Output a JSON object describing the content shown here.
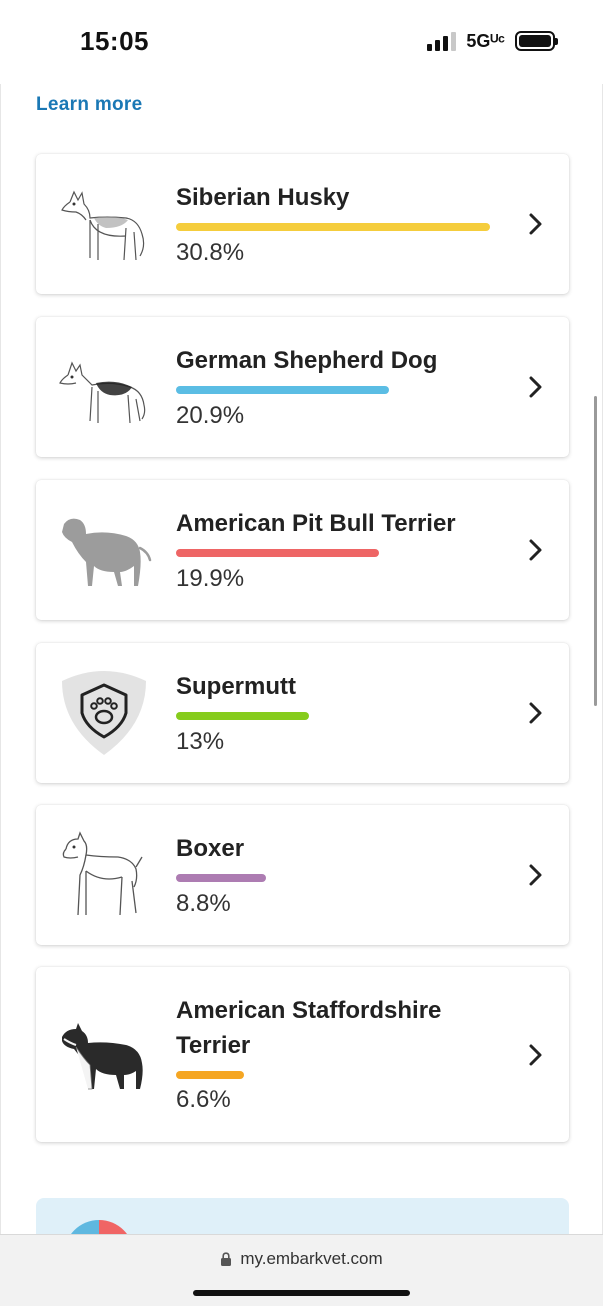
{
  "status_bar": {
    "time": "15:05",
    "network": "5Gᵁᶜ",
    "signal_bars": 3,
    "signal_bars_total": 4
  },
  "page": {
    "learn_more": "Learn more"
  },
  "breeds": [
    {
      "name": "Siberian Husky",
      "percent": "30.8%",
      "value": 30.8,
      "color": "#f5cd3c",
      "image": "siberian-husky-sketch"
    },
    {
      "name": "German Shepherd Dog",
      "percent": "20.9%",
      "value": 20.9,
      "color": "#5bbde4",
      "image": "german-shepherd-sketch"
    },
    {
      "name": "American Pit Bull Terrier",
      "percent": "19.9%",
      "value": 19.9,
      "color": "#ee6565",
      "image": "pit-bull-sketch"
    },
    {
      "name": "Supermutt",
      "percent": "13%",
      "value": 13,
      "color": "#86cc1c",
      "image": "supermutt-paw-shield"
    },
    {
      "name": "Boxer",
      "percent": "8.8%",
      "value": 8.8,
      "color": "#ad7cb2",
      "image": "boxer-sketch"
    },
    {
      "name": "American Staffordshire Terrier",
      "percent": "6.6%",
      "value": 6.6,
      "color": "#f5a623",
      "image": "amstaff-sketch"
    }
  ],
  "browser": {
    "url": "my.embarkvet.com"
  }
}
